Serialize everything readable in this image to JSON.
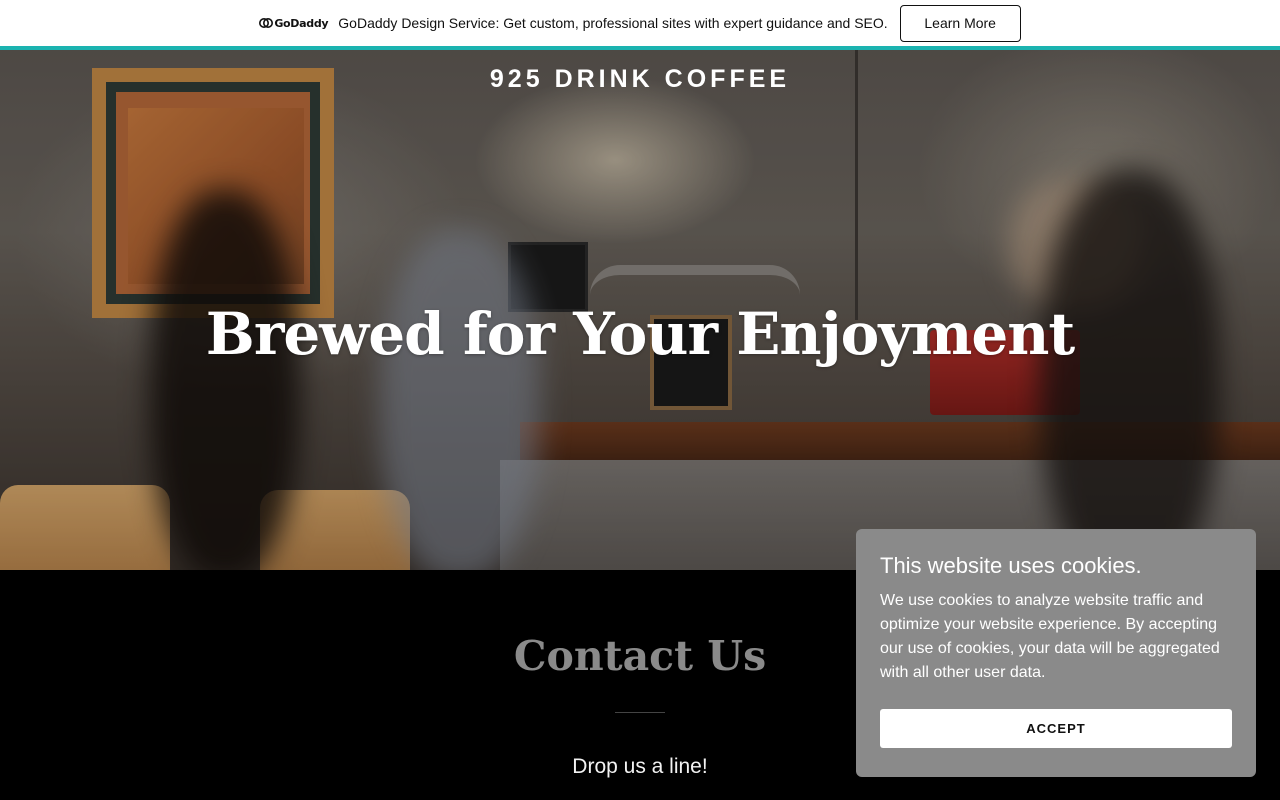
{
  "promo": {
    "logo_text": "GoDaddy",
    "message": "GoDaddy Design Service: Get custom, professional sites with expert guidance and SEO.",
    "button_label": "Learn More",
    "accent_color": "#1bb3b0"
  },
  "hero": {
    "site_title": "925 DRINK COFFEE",
    "heading": "Brewed for Your Enjoyment"
  },
  "contact": {
    "title": "Contact Us",
    "subtitle": "Drop us a line!"
  },
  "cookie_banner": {
    "title": "This website uses cookies.",
    "body": "We use cookies to analyze website traffic and optimize your website experience. By accepting our use of cookies, your data will be aggregated with all other user data.",
    "accept_label": "ACCEPT"
  }
}
